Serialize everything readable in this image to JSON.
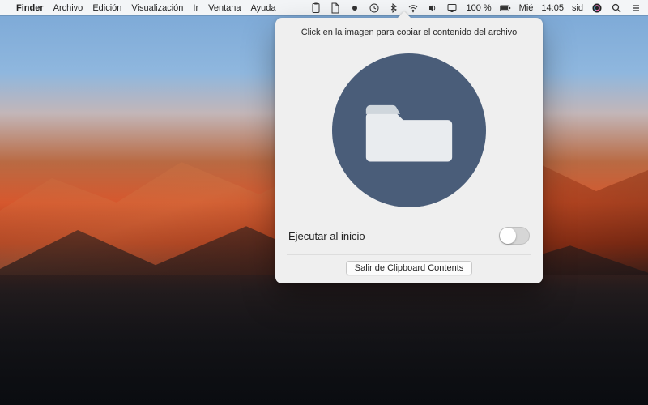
{
  "menubar": {
    "app_name": "Finder",
    "items": [
      "Archivo",
      "Edición",
      "Visualización",
      "Ir",
      "Ventana",
      "Ayuda"
    ],
    "status": {
      "battery_percent": "100 %",
      "battery_icon": "battery-icon",
      "day": "Mié",
      "time": "14:05",
      "user": "sid"
    }
  },
  "popover": {
    "title": "Click en la imagen para copiar el contenido del archivo",
    "launch_label": "Ejecutar al inicio",
    "launch_on": false,
    "quit_label": "Salir de Clipboard Contents",
    "icon": "folder-icon",
    "circle_color": "#4a5d79"
  }
}
